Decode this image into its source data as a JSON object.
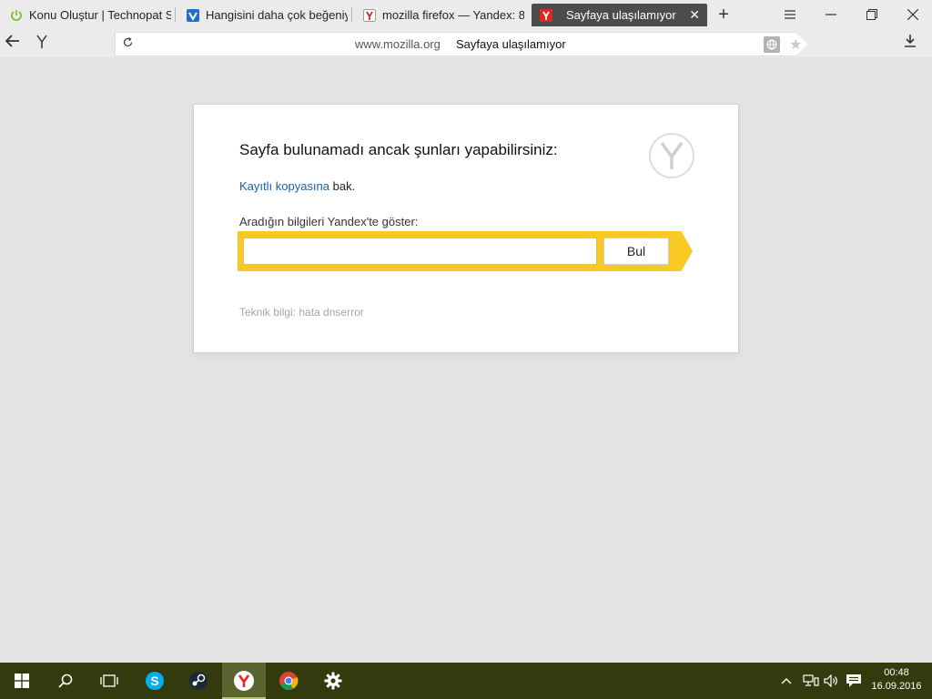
{
  "tabs": [
    {
      "title": "Konu Oluştur | Technopat S",
      "icon": "power-icon"
    },
    {
      "title": "Hangisini daha çok beğeniy",
      "icon": "check-shield-icon"
    },
    {
      "title": "mozilla firefox — Yandex: 8",
      "icon": "yandex-icon"
    },
    {
      "title": "Sayfaya ulaşılamıyor",
      "icon": "yandex-icon",
      "active": true
    }
  ],
  "nav": {
    "url_domain": "www.mozilla.org",
    "url_title": "Sayfaya ulaşılamıyor"
  },
  "error_page": {
    "heading": "Sayfa bulunamadı ancak şunları yapabilirsiniz:",
    "saved_copy_link": "Kayıtlı kopyasına",
    "saved_copy_suffix": " bak.",
    "search_label": "Aradığın bilgileri Yandex'te göster:",
    "search_value": "",
    "search_button": "Bul",
    "tech_info": "Teknik bilgi: hata dnserror"
  },
  "taskbar": {
    "time": "00:48",
    "date": "16.09.2016"
  },
  "colors": {
    "search_bar": "#f7c922",
    "link": "#1a5fa8",
    "taskbar": "#333a0d"
  }
}
